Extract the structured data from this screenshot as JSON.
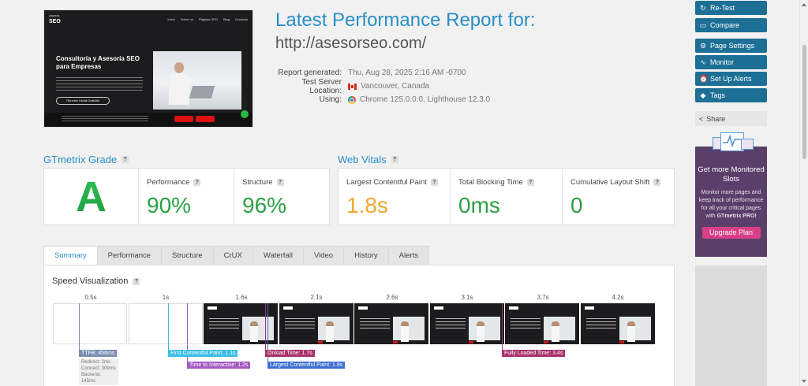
{
  "thumbnail": {
    "logo_top": "AGENCIA",
    "logo": "SEO",
    "nav": [
      "Inicio",
      "Sobre mí",
      "Páginas SEO",
      "Blog",
      "Contacto"
    ],
    "hero_title": "Consultoría y Asesoría SEO para Empresas",
    "hero_button": "Reunión Inicial Gratuita"
  },
  "report": {
    "title": "Latest Performance Report for:",
    "url": "http://asesorseo.com/",
    "meta": [
      {
        "label": "Report generated:",
        "value": "Thu, Aug 28, 2025 2:16 AM -0700"
      },
      {
        "label": "Test Server Location:",
        "value": "Vancouver, Canada",
        "icon": "canada-flag-icon"
      },
      {
        "label": "Using:",
        "value": "Chrome 125.0.0.0, Lighthouse 12.3.0",
        "icon": "chrome-icon"
      }
    ]
  },
  "grade": {
    "heading": "GTmetrix Grade",
    "letter": "A",
    "performance_label": "Performance",
    "performance": "90%",
    "structure_label": "Structure",
    "structure": "96%"
  },
  "vitals": {
    "heading": "Web Vitals",
    "lcp_label": "Largest Contentful Paint",
    "lcp": "1.8s",
    "tbt_label": "Total Blocking Time",
    "tbt": "0ms",
    "cls_label": "Cumulative Layout Shift",
    "cls": "0"
  },
  "sidebar": {
    "buttons": [
      {
        "label": "Re-Test",
        "icon": "refresh-icon"
      },
      {
        "label": "Compare",
        "icon": "compare-icon"
      },
      {
        "label": "Page Settings",
        "icon": "gear-icon"
      },
      {
        "label": "Monitor",
        "icon": "pulse-icon"
      },
      {
        "label": "Set Up Alerts",
        "icon": "alarm-icon"
      },
      {
        "label": "Tags",
        "icon": "tag-icon"
      }
    ],
    "share": "Share",
    "promo_title": "Get more Monitored Slots",
    "promo_text_1": "Monitor more pages and keep track of performance for all your critical pages with",
    "promo_text_2": "GTmetrix PRO!",
    "promo_button": "Upgrade Plan"
  },
  "tabs": [
    "Summary",
    "Performance",
    "Structure",
    "CrUX",
    "Waterfall",
    "Video",
    "History",
    "Alerts"
  ],
  "active_tab": "Summary",
  "speed": {
    "heading": "Speed Visualization",
    "ticks": [
      "0.5s",
      "1s",
      "1.6s",
      "2.1s",
      "2.6s",
      "3.1s",
      "3.7s",
      "4.2s"
    ],
    "ttfb": "TTFB: 456ms",
    "ttfb_details": [
      "Redirect: 2ms",
      "Connect: 309ms",
      "Backend: 145ms"
    ],
    "fcp": "First Contentful Paint: 1.1s",
    "tti": "Time to Interactive: 1.2s",
    "onload": "Onload Time: 1.7s",
    "lcp": "Largest Contentful Paint: 1.8s",
    "fully_loaded": "Fully Loaded Time: 3.4s"
  },
  "colors": {
    "brand_blue": "#2a8ec6",
    "button_blue": "#1d6f96",
    "grade_green": "#2aa243",
    "lcp_orange": "#f0a72f",
    "promo_purple": "#5a3f6a",
    "upgrade_pink": "#d83f87"
  }
}
